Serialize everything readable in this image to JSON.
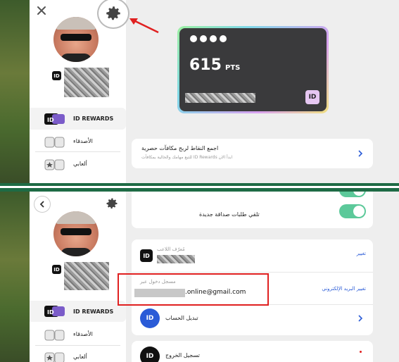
{
  "top_panel": {
    "sidebar": {
      "id_label": "ID",
      "menu": [
        {
          "label": "ID REWARDS",
          "icon": "id-rewards-icon",
          "active": true
        },
        {
          "label": "الأصدقاء",
          "icon": "friends-icon",
          "active": false
        },
        {
          "label": "ألعابي",
          "icon": "my-games-icon",
          "active": false
        }
      ]
    },
    "card": {
      "points_value": "615",
      "points_unit": "PTS",
      "id_logo": "ID"
    },
    "promo": {
      "title": "اجمع النقاط لربح مكافآت حصرية",
      "subtitle": "للتبع مهامك والحالية بمكافآت ID Rewards ابدأ الان"
    }
  },
  "bottom_panel": {
    "sidebar": {
      "id_label": "ID",
      "menu": [
        {
          "label": "ID REWARDS",
          "icon": "id-rewards-icon",
          "active": true
        },
        {
          "label": "الأصدقاء",
          "icon": "friends-icon",
          "active": false
        },
        {
          "label": "ألعابي",
          "icon": "my-games-icon",
          "active": false
        }
      ]
    },
    "settings": {
      "friend_requests_label": "تلقي طلبات صداقة جديدة",
      "player_id_label": "مُعرّف اللاعب",
      "change_label": "تغيير",
      "login_label": "مسجل دخول عبر",
      "email_value": ".online@gmail.com",
      "change_email_label": "تغيير البريد الإلكتروني",
      "switch_account_label": "تبديل الحساب",
      "logout_label": "تسجيل الخروج",
      "id_logo": "ID"
    }
  },
  "colors": {
    "accent_green": "#5cc99a",
    "link_blue": "#2a5bd7",
    "highlight_red": "#e02020",
    "divider_green": "#1e6b45"
  }
}
